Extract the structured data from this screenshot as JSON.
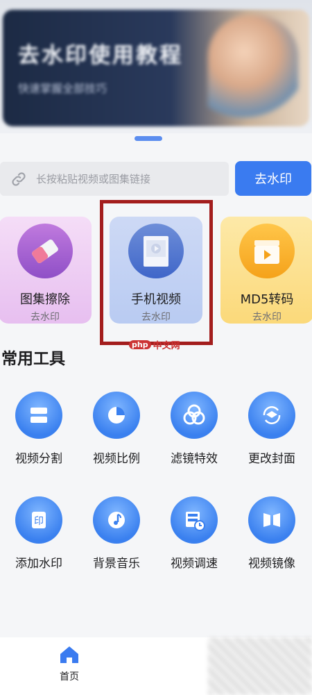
{
  "banner": {
    "title": "去水印使用教程",
    "subtitle": "快速掌握全部技巧"
  },
  "search": {
    "placeholder": "长按粘贴视频或图集链接",
    "button_label": "去水印"
  },
  "feature_cards": [
    {
      "title": "图集擦除",
      "subtitle": "去水印",
      "icon": "eraser-icon"
    },
    {
      "title": "手机视频",
      "subtitle": "去水印",
      "icon": "video-icon"
    },
    {
      "title": "MD5转码",
      "subtitle": "去水印",
      "icon": "clapperboard-icon"
    }
  ],
  "watermark": {
    "logo": "php",
    "text": "中文网"
  },
  "tools": {
    "title": "常用工具",
    "items": [
      {
        "label": "视频分割",
        "icon": "split-icon"
      },
      {
        "label": "视频比例",
        "icon": "pie-chart-icon"
      },
      {
        "label": "滤镜特效",
        "icon": "filter-icon"
      },
      {
        "label": "更改封面",
        "icon": "refresh-layers-icon"
      },
      {
        "label": "添加水印",
        "icon": "stamp-icon"
      },
      {
        "label": "背景音乐",
        "icon": "music-icon"
      },
      {
        "label": "视频调速",
        "icon": "speed-icon"
      },
      {
        "label": "视频镜像",
        "icon": "mirror-icon"
      }
    ]
  },
  "tabbar": {
    "items": [
      {
        "label": "首页",
        "icon": "home-icon"
      }
    ]
  },
  "colors": {
    "accent": "#3a7bf0",
    "highlight": "#a31d1d"
  }
}
